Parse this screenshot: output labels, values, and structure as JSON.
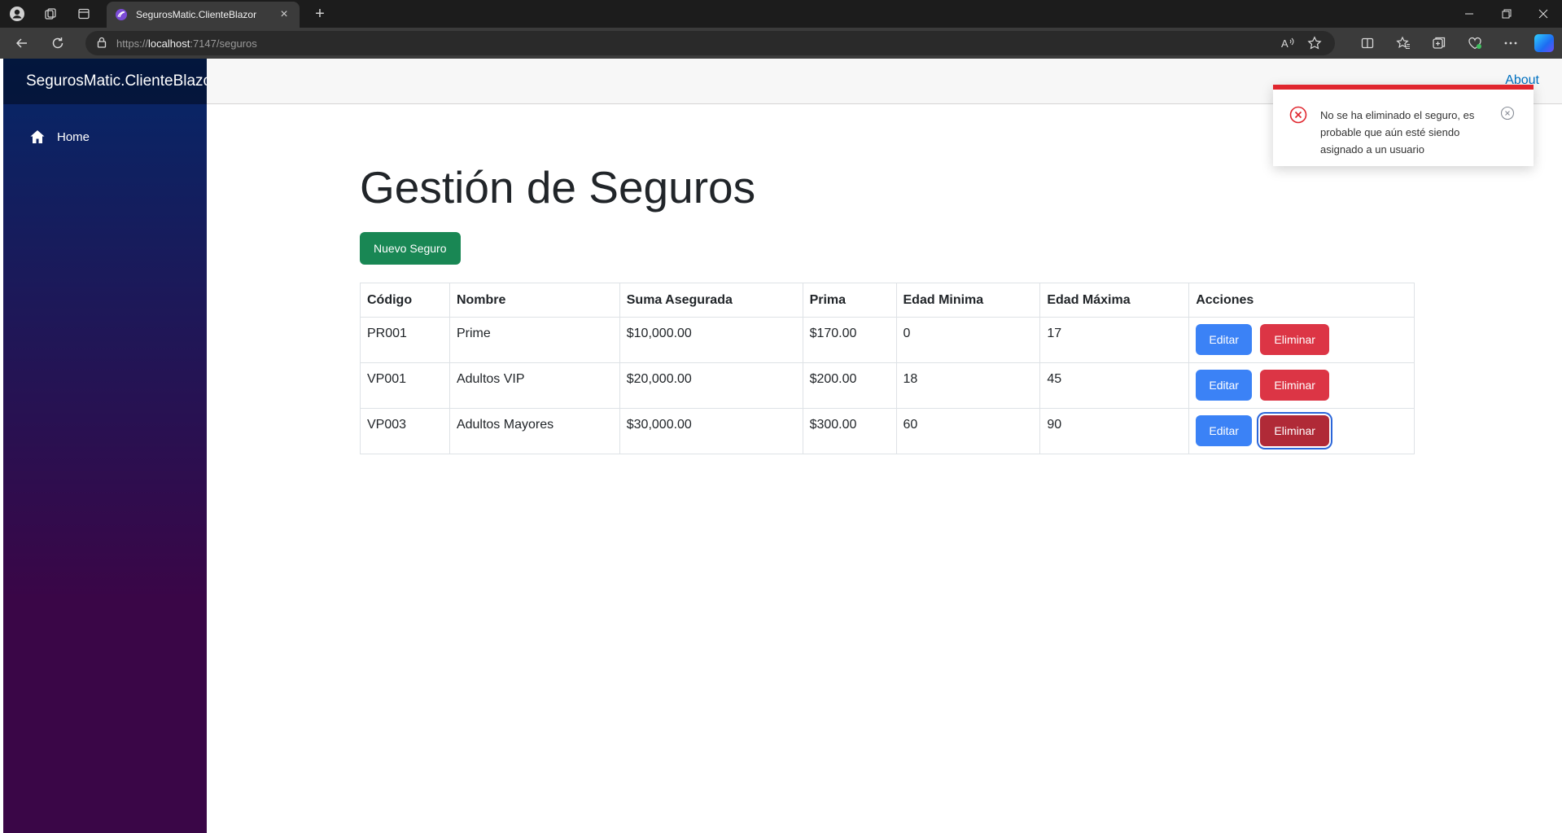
{
  "browser": {
    "tab_title": "SegurosMatic.ClienteBlazor",
    "url_scheme": "https://",
    "url_host": "localhost",
    "url_rest": ":7147/seguros"
  },
  "sidebar": {
    "brand": "SegurosMatic.ClienteBlazor",
    "items": [
      {
        "label": "Home",
        "icon": "home-icon"
      }
    ]
  },
  "header": {
    "about_label": "About"
  },
  "main": {
    "title": "Gestión de Seguros",
    "new_button_label": "Nuevo Seguro",
    "table": {
      "columns": [
        "Código",
        "Nombre",
        "Suma Asegurada",
        "Prima",
        "Edad Minima",
        "Edad Máxima",
        "Acciones"
      ],
      "rows": [
        {
          "codigo": "PR001",
          "nombre": "Prime",
          "suma": "$10,000.00",
          "prima": "$170.00",
          "edad_min": "0",
          "edad_max": "17"
        },
        {
          "codigo": "VP001",
          "nombre": "Adultos VIP",
          "suma": "$20,000.00",
          "prima": "$200.00",
          "edad_min": "18",
          "edad_max": "45"
        },
        {
          "codigo": "VP003",
          "nombre": "Adultos Mayores",
          "suma": "$30,000.00",
          "prima": "$300.00",
          "edad_min": "60",
          "edad_max": "90"
        }
      ],
      "edit_label": "Editar",
      "delete_label": "Eliminar"
    }
  },
  "toast": {
    "type": "error",
    "message": "No se ha eliminado el seguro, es probable que aún esté siendo asignado a un usuario",
    "accent_color": "#e0262e"
  },
  "colors": {
    "success": "#198754",
    "primary": "#3b82f6",
    "danger": "#dc3545",
    "link": "#0071c1"
  }
}
